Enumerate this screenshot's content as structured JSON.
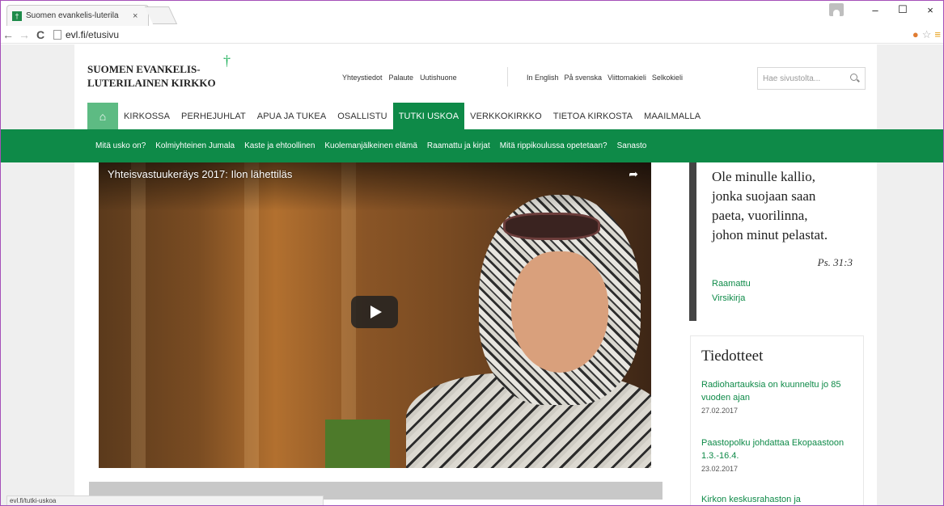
{
  "browser": {
    "tab_title": "Suomen evankelis-luterila",
    "tab_close": "×",
    "url_domain": "evl.fi",
    "url_path": "/etusivu",
    "window_minimize": "–",
    "window_maximize": "☐",
    "window_close": "×",
    "status_url": "evl.fi/tutki-uskoa"
  },
  "header": {
    "logo_line1": "SUOMEN EVANKELIS-",
    "logo_line2": "LUTERILAINEN KIRKKO",
    "logo_cross": "†",
    "utility_links": [
      "Yhteystiedot",
      "Palaute",
      "Uutishuone"
    ],
    "language_links": [
      "In English",
      "På svenska",
      "Viittomakieli",
      "Selkokieli"
    ],
    "search_placeholder": "Hae sivustolta..."
  },
  "main_nav": {
    "home_icon": "home-icon",
    "items": [
      "KIRKOSSA",
      "PERHEJUHLAT",
      "APUA JA TUKEA",
      "OSALLISTU",
      "TUTKI USKOA",
      "VERKKOKIRKKO",
      "TIETOA KIRKOSTA",
      "MAAILMALLA"
    ],
    "active": "TUTKI USKOA"
  },
  "sub_nav": {
    "items": [
      "Mitä usko on?",
      "Kolmiyhteinen Jumala",
      "Kaste ja ehtoollinen",
      "Kuolemanjälkeinen elämä",
      "Raamattu ja kirjat",
      "Mitä rippikoulussa opetetaan?",
      "Sanasto"
    ]
  },
  "video": {
    "title": "Yhteisvastuukeräys 2017: Ilon lähettiläs",
    "share_icon": "share-icon",
    "play_icon": "play-icon"
  },
  "verse": {
    "lines": [
      "Ole minulle kallio,",
      "jonka suojaan saan",
      "paeta, vuorilinna,",
      "johon minut pelastat."
    ],
    "reference": "Ps. 31:3",
    "links": [
      "Raamattu",
      "Virsikirja"
    ]
  },
  "news": {
    "heading": "Tiedotteet",
    "items": [
      {
        "title": "Radiohartauksia on kuunneltu jo 85 vuoden ajan",
        "date": "27.02.2017"
      },
      {
        "title": "Paastopolku johdattaa Ekopaastoon 1.3.-16.4.",
        "date": "23.02.2017"
      },
      {
        "title": "Kirkon keskusrahaston ja",
        "date": ""
      }
    ]
  },
  "colors": {
    "brand_green": "#0e8a48",
    "home_green": "#5dbb83",
    "window_border": "#a54fb8"
  }
}
